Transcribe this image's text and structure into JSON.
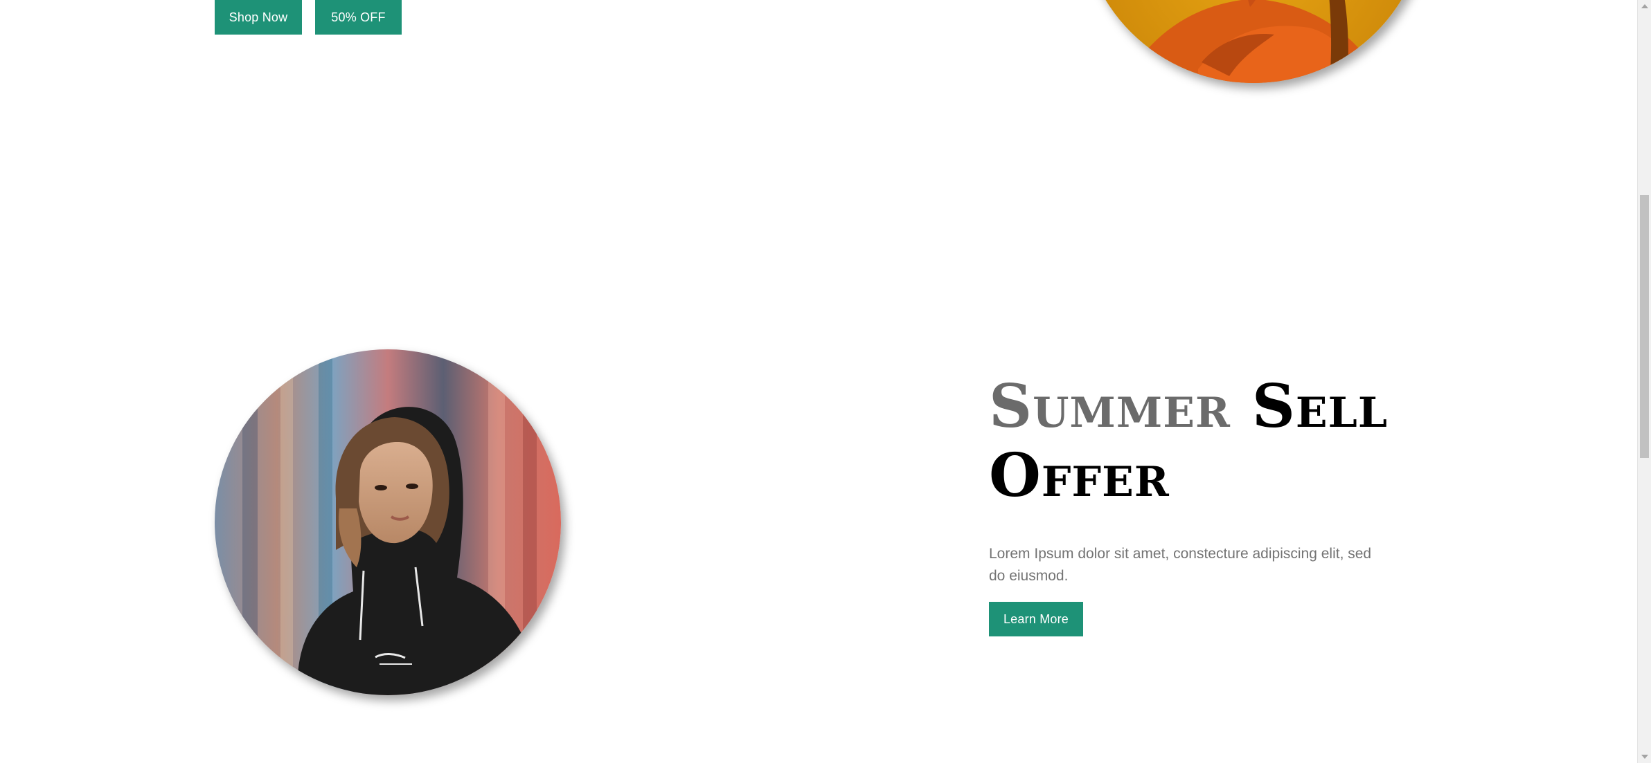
{
  "hero": {
    "shop_now_label": "Shop Now",
    "discount_label": "50% OFF"
  },
  "offer": {
    "title_part1": "Summer",
    "title_part2": "Sell",
    "title_part3": "Offer",
    "description": "Lorem Ipsum dolor sit amet, constecture adipiscing elit, sed do eiusmod.",
    "learn_more_label": "Learn More"
  },
  "colors": {
    "accent": "#1e9277",
    "heading_grey": "#6b6b6b",
    "heading_black": "#000000",
    "body_text": "#737373"
  },
  "icons": {
    "scroll_up": "chevron-up-icon",
    "scroll_down": "chevron-down-icon"
  }
}
